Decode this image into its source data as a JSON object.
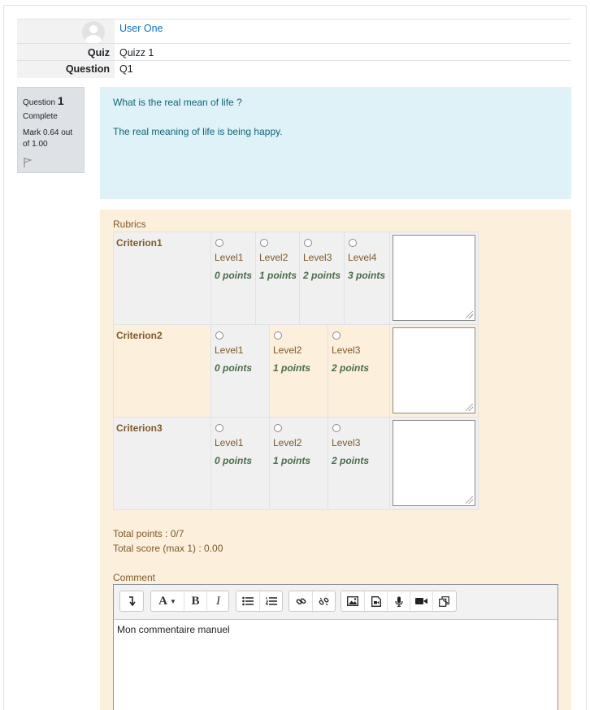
{
  "summary": {
    "user_name": "User One",
    "quiz_label": "Quiz",
    "quiz_value": "Quizz 1",
    "question_label": "Question",
    "question_value": "Q1"
  },
  "question_info": {
    "question_word": "Question",
    "number": "1",
    "state": "Complete",
    "mark": "Mark 0.64 out of 1.00"
  },
  "question_text": {
    "line1": "What is the real mean of life ?",
    "line2": "The real meaning of life is being happy."
  },
  "rubric": {
    "title": "Rubrics",
    "criteria": [
      {
        "name": "Criterion1",
        "levels": [
          {
            "label": "Level1",
            "points": "0 points"
          },
          {
            "label": "Level2",
            "points": "1 points"
          },
          {
            "label": "Level3",
            "points": "2 points"
          },
          {
            "label": "Level4",
            "points": "3 points"
          }
        ]
      },
      {
        "name": "Criterion2",
        "levels": [
          {
            "label": "Level1",
            "points": "0 points"
          },
          {
            "label": "Level2",
            "points": "1 points"
          },
          {
            "label": "Level3",
            "points": "2 points"
          }
        ]
      },
      {
        "name": "Criterion3",
        "levels": [
          {
            "label": "Level1",
            "points": "0 points"
          },
          {
            "label": "Level2",
            "points": "1 points"
          },
          {
            "label": "Level3",
            "points": "2 points"
          }
        ]
      }
    ],
    "total_points": "Total points : 0/7",
    "total_score": "Total score (max 1) : 0.00"
  },
  "comment": {
    "label": "Comment",
    "content": "Mon commentaire manuel",
    "toolbar_icons": [
      "collapse-icon",
      "font-color-icon",
      "bold-icon",
      "italic-icon",
      "unordered-list-icon",
      "ordered-list-icon",
      "link-icon",
      "unlink-icon",
      "image-icon",
      "media-icon",
      "record-audio-icon",
      "record-video-icon",
      "manage-files-icon"
    ]
  },
  "colors": {
    "link": "#0f6cbf",
    "info_bg": "#def2f8",
    "feedback_bg": "#fcefdc",
    "feedback_text": "#7d5a29",
    "points_text": "#4a6c4b"
  }
}
